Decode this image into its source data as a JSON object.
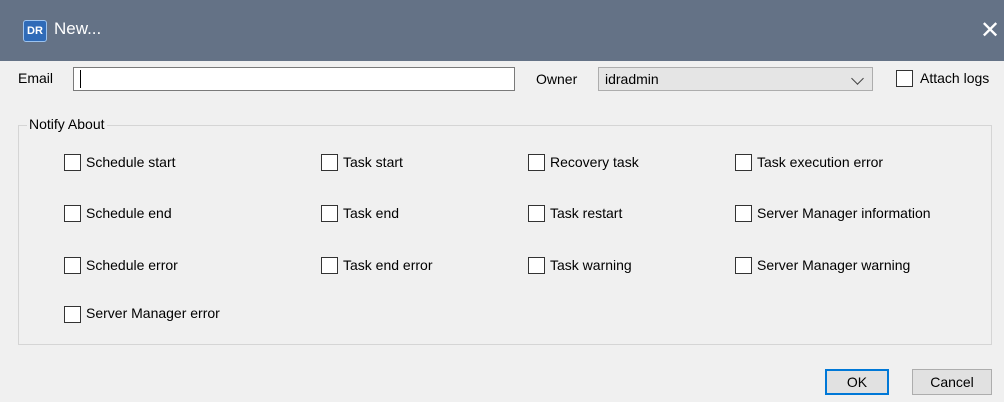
{
  "window": {
    "title": "New...",
    "icon_text": "DR",
    "close_glyph": "✕"
  },
  "form": {
    "email_label": "Email",
    "email_value": "",
    "owner_label": "Owner",
    "owner_value": "idradmin",
    "attach_logs_label": "Attach logs",
    "attach_logs_checked": false
  },
  "notify": {
    "title": "Notify About",
    "options": [
      {
        "label": "Schedule start",
        "checked": false
      },
      {
        "label": "Task start",
        "checked": false
      },
      {
        "label": "Recovery task",
        "checked": false
      },
      {
        "label": "Task execution error",
        "checked": false
      },
      {
        "label": "Schedule end",
        "checked": false
      },
      {
        "label": "Task end",
        "checked": false
      },
      {
        "label": "Task restart",
        "checked": false
      },
      {
        "label": "Server Manager information",
        "checked": false
      },
      {
        "label": "Schedule error",
        "checked": false
      },
      {
        "label": "Task end error",
        "checked": false
      },
      {
        "label": "Task warning",
        "checked": false
      },
      {
        "label": "Server Manager warning",
        "checked": false
      },
      {
        "label": "Server Manager error",
        "checked": false
      }
    ]
  },
  "buttons": {
    "ok": "OK",
    "cancel": "Cancel"
  },
  "colors": {
    "titlebar": "#647286",
    "accent": "#0078d7"
  }
}
